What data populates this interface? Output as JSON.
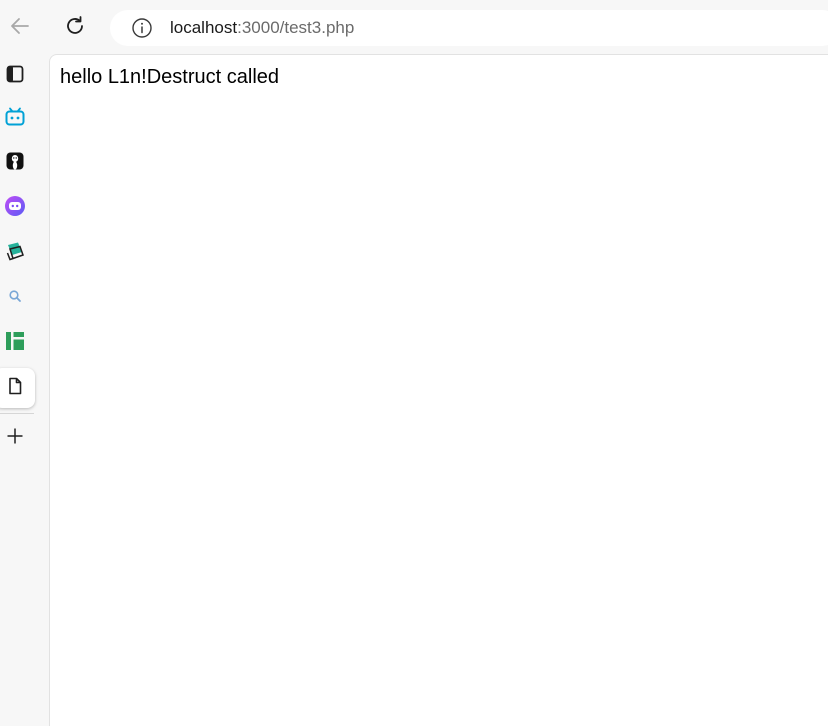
{
  "browser": {
    "address_bar": {
      "host": "localhost",
      "path": ":3000/test3.php"
    },
    "icons": {
      "back": "back-arrow-icon",
      "reload": "reload-icon",
      "site_info": "info-icon"
    }
  },
  "sidebar": {
    "items": [
      {
        "name": "tab-view-icon"
      },
      {
        "name": "bilibili-icon"
      },
      {
        "name": "qq-penguin-icon"
      },
      {
        "name": "chat-bot-icon"
      },
      {
        "name": "notebook-icon"
      },
      {
        "name": "search-icon"
      },
      {
        "name": "dashboard-icon"
      },
      {
        "name": "document-icon"
      },
      {
        "name": "add-icon"
      }
    ],
    "active_item": "document-icon"
  },
  "page": {
    "body_text": "hello L1n!Destruct called"
  },
  "colors": {
    "bilibili": "#00a1d6",
    "chat_bot": "#8b4cf5",
    "dashboard": "#2e9e5b",
    "notebook": "#25b19a",
    "search": "#7aa7d6"
  }
}
